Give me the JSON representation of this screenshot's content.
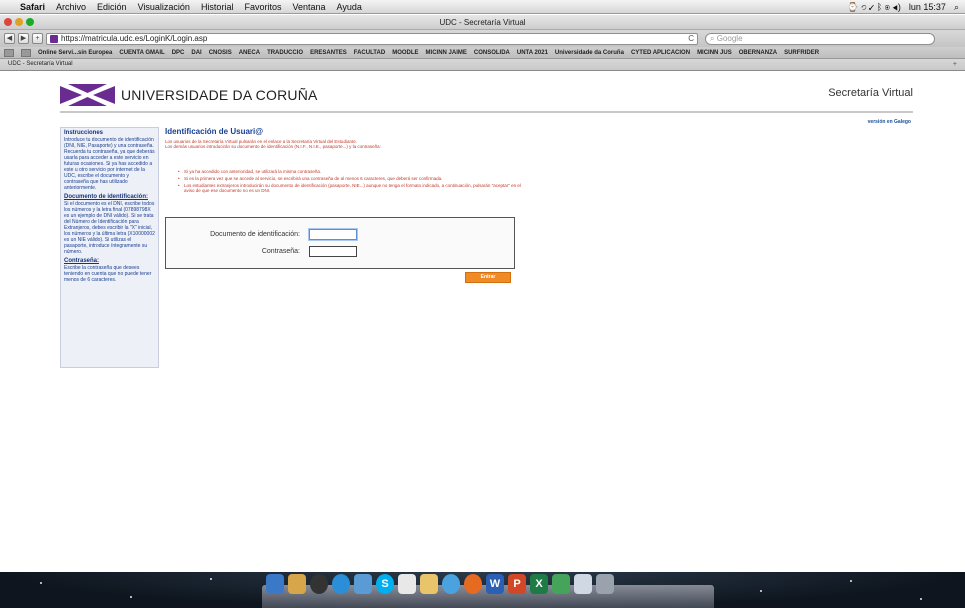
{
  "menubar": {
    "app": "Safari",
    "items": [
      "Archivo",
      "Edición",
      "Visualización",
      "Historial",
      "Favoritos",
      "Ventana",
      "Ayuda"
    ],
    "clock": "lun 15:37"
  },
  "window": {
    "title": "UDC - Secretaría Virtual"
  },
  "toolbar": {
    "url": "https://matricula.udc.es/LoginK/Login.asp",
    "search_placeholder": "Google"
  },
  "bookmarks": [
    "Online Servi...sin Europea",
    "CUENTA GMAIL",
    "DPC",
    "DAI",
    "CNOSIS",
    "ANECA",
    "TRADUCCIO",
    "ERESANTES",
    "FACULTAD",
    "MOODLE",
    "MICINN JAIME",
    "CONSOLIDA",
    "UNTA 2021",
    "Universidade da Coruña",
    "CYTED APLICACION",
    "MICINN JUS",
    "OBERNANZA",
    "SURFRIDER"
  ],
  "tab": {
    "title": "UDC - Secretaría Virtual"
  },
  "header": {
    "logo_text": "UNIVERSIDADE DA CORUÑA",
    "site_title": "Secretaría Virtual",
    "lang_link": "versión en Galego"
  },
  "sidebar": {
    "sections": [
      {
        "heading": "Instrucciones",
        "text": "Introduce tu documento de identificación (DNI, NIE, Pasaporte) y una contraseña. Recuerda tu contraseña, ya que deberás usarla para acceder a este servicio en futuras ocasiones. Si ya has accedido a este u otro servicio por internet de la UDC, escribe el documento y contraseña que has utilizado anteriormente."
      },
      {
        "heading": "Documento de identificación:",
        "text": "Si el documento es el DNI, escribe todos los números y la letra final (07898798X es un ejemplo de DNI válido). Si se trata del Número de Identificación para Extranjeros, debes escribir la \"X\" inicial, los números y la última letra (X10000002 es un NIE válido). Si utilizas el pasaporte, introduce íntegramente su número."
      },
      {
        "heading": "Contraseña:",
        "text": "Escribe la contraseña que desees teniendo en cuenta que no puede tener menos de 6 caracteres."
      }
    ]
  },
  "main": {
    "title": "Identificación de Usuari@",
    "intro_1": "Los usuarios de la Secretaría Virtual pulsarán en el enlace a la Secretaría Virtual del Estudiante.",
    "intro_2": "Los demás usuarios introducirán su documento de identificación (N.I.F., N.I.E., pasaporte...) y la contraseña:",
    "notes": [
      "Si ya ha accedido con anterioridad, se utilizará la misma contraseña.",
      "Si es la primera vez que se accede al servicio, se escribirá una contraseña de al menos 6 caracteres, que deberá ser confirmada.",
      "Los estudiantes extranjeros introducirán su documento de identificación (pasaporte, NIE...) aunque no tenga el formato indicado, a continuación, pulsarán \"aceptar\" en el aviso de que ese documento no es un DNI."
    ],
    "doc_label": "Documento de identificación:",
    "password_label": "Contraseña:",
    "submit_label": "Entrar"
  },
  "dock": {
    "icons": [
      "finder-icon",
      "mail-stamp-icon",
      "dvd-player-icon",
      "safari-icon",
      "preview-icon",
      "skype-icon",
      "mail-icon",
      "notes-icon",
      "itunes-icon",
      "firefox-icon",
      "word-icon",
      "powerpoint-icon",
      "excel-icon",
      "entourage-icon",
      "image-icon",
      "trash-icon"
    ]
  }
}
